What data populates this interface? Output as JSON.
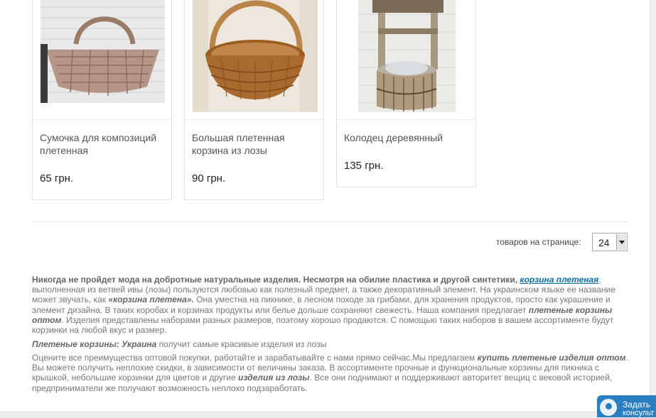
{
  "products": [
    {
      "title": "Сумочка для композиций плетенная",
      "price": "65 грн.",
      "image_icon": "woven-handbag-image"
    },
    {
      "title": "Большая плетенная корзина из лозы",
      "price": "90 грн.",
      "image_icon": "wicker-basket-image"
    },
    {
      "title": "Колодец деревянный",
      "price": "135 грн.",
      "image_icon": "wooden-well-image"
    }
  ],
  "per_page": {
    "label": "товаров на странице:",
    "value": "24"
  },
  "description": {
    "p1_bold": "Никогда не пройдет мода на добротные натуральные изделия. Несмотря на обилие пластика и другой синтетики,",
    "p1_link": "корзина плетеная",
    "p1_after_link": ",",
    "p1_text1": "выполненная  из ветвей ивы (лозы) пользуются любовью как полезный предмет, а также декоративный элемент. На украинском языке ее название может звучать, как",
    "p1_em1": "«корзина плетена».",
    "p1_text2": "Она уместна на пикнике, в лесном походе за грибами,  для  хранения продуктов, просто как украшение и элемент дизайна. В таких коробах и корзинах продукты или белье дольше сохраняют свежесть. Наша компания предлагает",
    "p1_em2": "плетеные корзины оптом",
    "p1_text3": ".  Изделия представлены наборами разных размеров, поэтому хорошо  продаются.  С помощью таких наборов в вашем ассортименте будут корзинки на любой вкус и размер.",
    "p2_em": "Плетеные корзины:  Украина",
    "p2_text": " получит самые красивые изделия из лозы",
    "p3_text1": " Оцените все преимущества оптовой покупки, работайте и зарабатывайте с нами прямо сейчас.Мы предлагаем",
    "p3_em1": "купить плетеные изделия оптом",
    "p3_text2": ". Вы можете получить неплохие скидки, в зависимости от величины заказа. В ассортименте прочные и функциональные корзины для пикника с крышкой,  небольшие корзинки для цветов и другие",
    "p3_em2": "изделия из лозы",
    "p3_text3": ". Все они поднимают и поддерживают авторитет  вещиц с вековой историей,  предприниматели же получают  возможность неплохо подзаработать."
  },
  "consult_widget": {
    "line1": "Задать",
    "line2": "консульт",
    "icon": "chat-icon"
  }
}
